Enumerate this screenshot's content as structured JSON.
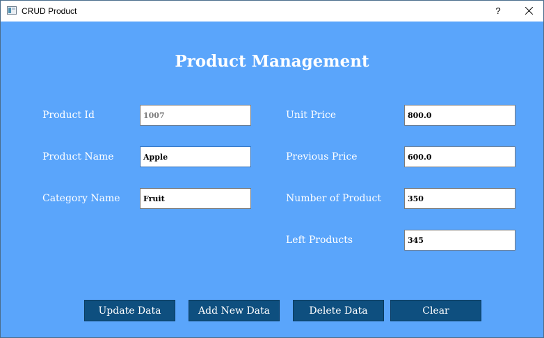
{
  "window": {
    "title": "CRUD Product",
    "help_label": "?"
  },
  "page": {
    "title": "Product Management"
  },
  "form": {
    "product_id": {
      "label": "Product Id",
      "value": "1007"
    },
    "product_name": {
      "label": "Product Name",
      "value": "Apple"
    },
    "category_name": {
      "label": "Category Name",
      "value": "Fruit"
    },
    "unit_price": {
      "label": "Unit Price",
      "value": "800.0"
    },
    "previous_price": {
      "label": "Previous Price",
      "value": "600.0"
    },
    "number_of_product": {
      "label": "Number of Product",
      "value": "350"
    },
    "left_products": {
      "label": "Left Products",
      "value": "345"
    }
  },
  "buttons": {
    "update": "Update Data",
    "add": "Add New Data",
    "delete": "Delete Data",
    "clear": "Clear"
  },
  "colors": {
    "background": "#5aa5fb",
    "button": "#0e4f7f",
    "text": "#ffffff"
  },
  "icons": {
    "app": "app-window-icon",
    "close": "close-icon"
  }
}
